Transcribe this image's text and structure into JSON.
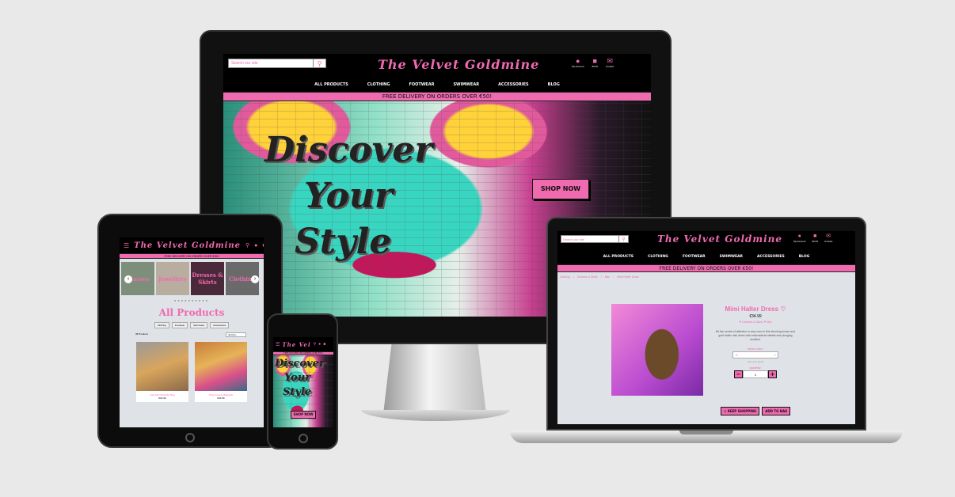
{
  "site": {
    "brand": "The Velvet Goldmine",
    "brand_short": "The Vel",
    "search_placeholder": "Search our site",
    "nav": [
      "ALL PRODUCTS",
      "CLOTHING",
      "FOOTWEAR",
      "SWIMWEAR",
      "ACCESSORIES",
      "BLOG"
    ],
    "delivery_banner": "FREE DELIVERY ON ORDERS OVER €50!",
    "account_label": "My Account",
    "bag_label": "€0.00",
    "contact_label": "Contact"
  },
  "hero": {
    "line1": "Discover",
    "line2": "Your",
    "line3": "Style",
    "cta": "SHOP NOW"
  },
  "tablet": {
    "categories": [
      "Glasses",
      "Jewellery",
      "Dresses & Skirts",
      "Clothing"
    ],
    "page_title": "All Products",
    "filters": [
      "Clothing",
      "Footwear",
      "Swimwear",
      "Accessories"
    ],
    "result_count": "38 Products",
    "sort_label": "Sort by...",
    "products": [
      {
        "name": "Oda Mini Shoulder Bag",
        "price": "€24.99"
      },
      {
        "name": "Tiras Colours Bagsette",
        "price": "€44.99"
      }
    ]
  },
  "laptop_page": {
    "breadcrumb": [
      "Clothing",
      "Dresses & Skirts",
      "Mini",
      "Mimi Halter Dress"
    ],
    "product_name": "Mimi Halter Dress",
    "price": "€34.99",
    "tags": [
      "Dresses & Skirts",
      "Mini"
    ],
    "description": "Be the centre of attention in any room in this stunning brown and gold halter mini dress with embroidered details and plunging neckline.",
    "size_label": "select size:",
    "size_value": "S",
    "size_guide": "view size guide",
    "quantity_label": "quantity:",
    "quantity_value": "1",
    "keep_shopping": "< KEEP SHOPPING",
    "add_to_bag": "ADD TO BAG"
  },
  "colors": {
    "accent": "#f06ab0",
    "dark": "#000000",
    "panel": "#dfe3e8"
  }
}
